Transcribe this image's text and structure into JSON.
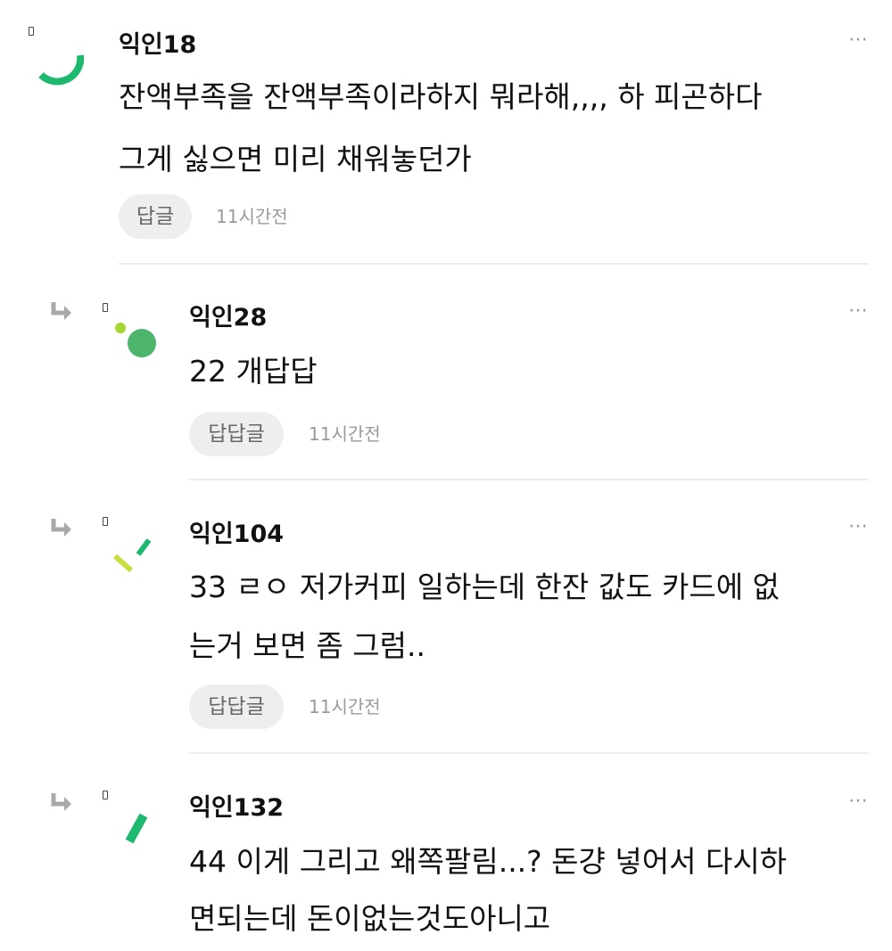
{
  "comments": [
    {
      "nickname": "익인18",
      "lines": [
        "잔액부족을 잔액부족이라하지 뭐라해,,,, 하 피곤하다",
        "그게 싫으면 미리 채워놓던가"
      ],
      "reply_label": "답글",
      "time": "11시간전",
      "more": "⋯"
    },
    {
      "nickname": "익인28",
      "lines": [
        "22 개답답"
      ],
      "reply_label": "답답글",
      "time": "11시간전",
      "more": "⋯"
    },
    {
      "nickname": "익인104",
      "lines": [
        "33 ㄹㅇ 저가커피 일하는데 한잔 값도 카드에 없",
        "는거 보면 좀 그럼.."
      ],
      "reply_label": "답답글",
      "time": "11시간전",
      "more": "⋯"
    },
    {
      "nickname": "익인132",
      "lines": [
        "44 이게 그리고 왜쪽팔림...? 돈걍 넣어서 다시하",
        "면되는데 돈이없는것도아니고"
      ],
      "more": "⋯"
    }
  ],
  "icons": {
    "reply_arrow": "reply-arrow-icon",
    "more": "more-options-icon",
    "rank": "rank-badge-icon"
  },
  "colors": {
    "accent_green": "#1db96f",
    "lime": "#a3d62e",
    "circle_green": "#4cb56b",
    "yellow_green": "#c9dd3c"
  }
}
